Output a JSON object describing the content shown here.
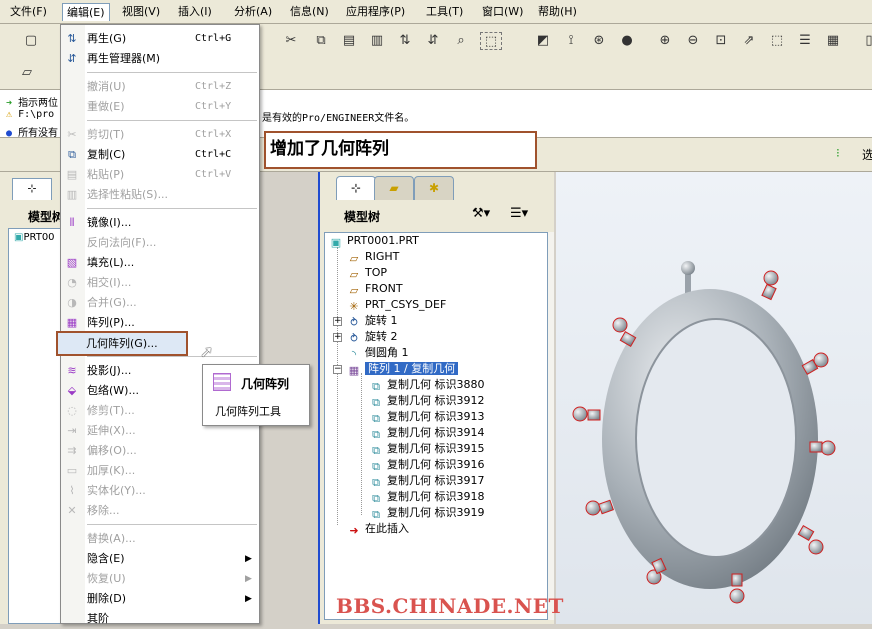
{
  "menubar": {
    "items": [
      {
        "label": "文件(F)"
      },
      {
        "label": "编辑(E)"
      },
      {
        "label": "视图(V)"
      },
      {
        "label": "插入(I)"
      },
      {
        "label": "分析(A)"
      },
      {
        "label": "信息(N)"
      },
      {
        "label": "应用程序(P)"
      },
      {
        "label": "工具(T)"
      },
      {
        "label": "窗口(W)"
      },
      {
        "label": "帮助(H)"
      }
    ]
  },
  "messages": {
    "line1": "指示两位",
    "line2a": "F:\\pro",
    "line2b": "是有效的Pro/ENGINEER文件名。",
    "line3": "所有没有"
  },
  "annotation": "增加了几何阵列",
  "left_panel": {
    "title": "模型树",
    "root": "PRT00"
  },
  "edit_menu": {
    "items": [
      {
        "label": "再生(G)",
        "shortcut": "Ctrl+G"
      },
      {
        "label": "再生管理器(M)",
        "shortcut": ""
      },
      {
        "label": "撤消(U)",
        "shortcut": "Ctrl+Z"
      },
      {
        "label": "重做(E)",
        "shortcut": "Ctrl+Y"
      },
      {
        "label": "剪切(T)",
        "shortcut": "Ctrl+X"
      },
      {
        "label": "复制(C)",
        "shortcut": "Ctrl+C"
      },
      {
        "label": "粘贴(P)",
        "shortcut": "Ctrl+V"
      },
      {
        "label": "选择性粘贴(S)...",
        "shortcut": ""
      },
      {
        "label": "镜像(I)...",
        "shortcut": ""
      },
      {
        "label": "反向法向(F)...",
        "shortcut": ""
      },
      {
        "label": "填充(L)...",
        "shortcut": ""
      },
      {
        "label": "相交(I)...",
        "shortcut": ""
      },
      {
        "label": "合并(G)...",
        "shortcut": ""
      },
      {
        "label": "阵列(P)...",
        "shortcut": ""
      },
      {
        "label": "几何阵列(G)...",
        "shortcut": ""
      },
      {
        "label": "投影(J)...",
        "shortcut": ""
      },
      {
        "label": "包络(W)...",
        "shortcut": ""
      },
      {
        "label": "修剪(T)...",
        "shortcut": ""
      },
      {
        "label": "延伸(X)...",
        "shortcut": ""
      },
      {
        "label": "偏移(O)...",
        "shortcut": ""
      },
      {
        "label": "加厚(K)...",
        "shortcut": ""
      },
      {
        "label": "实体化(Y)...",
        "shortcut": ""
      },
      {
        "label": "移除...",
        "shortcut": ""
      },
      {
        "label": "替换(A)...",
        "shortcut": ""
      },
      {
        "label": "隐含(E)",
        "shortcut": ""
      },
      {
        "label": "恢复(U)",
        "shortcut": ""
      },
      {
        "label": "删除(D)",
        "shortcut": ""
      },
      {
        "label": "其阶",
        "shortcut": ""
      }
    ]
  },
  "tooltip": {
    "title": "几何阵列",
    "body": "几何阵列工具"
  },
  "model_tree": {
    "title": "模型树",
    "root": "PRT0001.PRT",
    "nodes": [
      "RIGHT",
      "TOP",
      "FRONT",
      "PRT_CSYS_DEF",
      "旋转 1",
      "旋转 2",
      "倒圆角 1",
      "阵列 1 / 复制几何"
    ],
    "children": [
      "复制几何 标识3880",
      "复制几何 标识3912",
      "复制几何 标识3913",
      "复制几何 标识3914",
      "复制几何 标识3915",
      "复制几何 标识3916",
      "复制几何 标识3917",
      "复制几何 标识3918",
      "复制几何 标识3919"
    ],
    "insert_here": "在此插入"
  },
  "status_right": "选",
  "watermark": "BBS.CHINADE.NET"
}
